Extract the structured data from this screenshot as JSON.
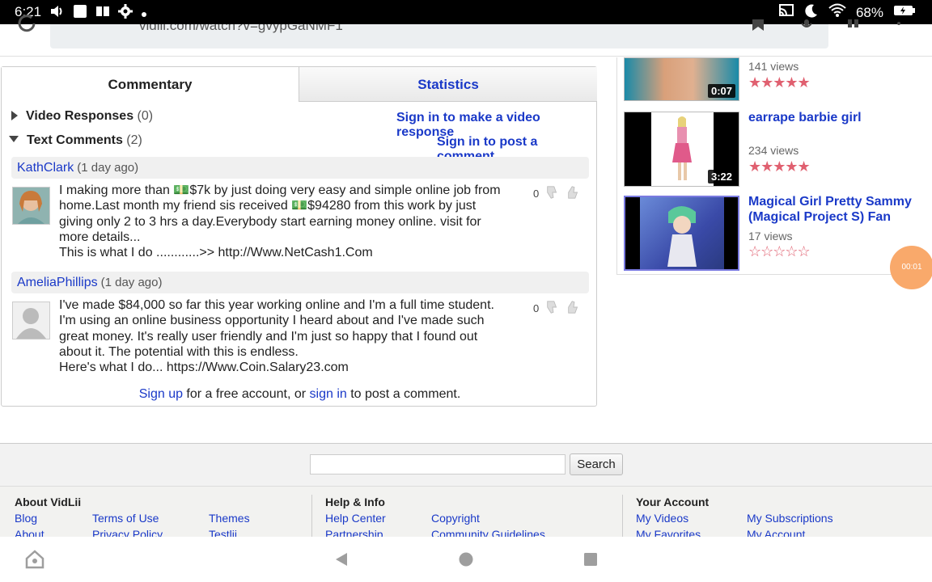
{
  "status_bar": {
    "time": "6:21",
    "battery": "68%"
  },
  "browser": {
    "url_fragment": "vidlii.com/watch?v=gvypGaNMF1"
  },
  "tabs": {
    "commentary": "Commentary",
    "statistics": "Statistics"
  },
  "sections": {
    "video_responses_label": "Video Responses",
    "video_responses_count": "(0)",
    "text_comments_label": "Text Comments",
    "text_comments_count": "(2)",
    "sign_in_video_response": "Sign in to make a video response",
    "sign_in_comment": "Sign in to post a comment"
  },
  "comments": [
    {
      "user": "KathClark",
      "ago": "(1 day ago)",
      "lines": [
        "I making more than 💵$7k by just doing very easy and simple online job from",
        "home.Last month my friend sis received 💵$94280 from this work by just",
        "giving only 2 to 3 hrs a day.Everybody start earning money online. visit for",
        "more details...",
        "This is what I do ............>> http://Www.NetCash1.Com"
      ],
      "votes": "0"
    },
    {
      "user": "AmeliaPhillips",
      "ago": "(1 day ago)",
      "lines": [
        "I've made $84,000 so far this year working online and I'm a full time student.",
        "I'm using an online business opportunity I heard about and I've made such",
        "great money. It's really user friendly and I'm just so happy that I found out",
        "about it. The potential with this is endless.",
        "Here's what I do... https://Www.Coin.Salary23.com"
      ],
      "votes": "0"
    }
  ],
  "signup_line": {
    "sign_up": "Sign up",
    "middle": " for a free account, or ",
    "sign_in": "sign in",
    "end": " to post a comment."
  },
  "related": [
    {
      "title": "",
      "views": "141 views",
      "duration": "0:07",
      "rating": 5
    },
    {
      "title": "earrape barbie girl",
      "views": "234 views",
      "duration": "3:22",
      "rating": 5
    },
    {
      "title": "Magical Girl Pretty Sammy (Magical Project S) Fan",
      "views": "17 views",
      "duration": "",
      "rating": 0
    }
  ],
  "bubble_text": "00:01",
  "footer": {
    "search_button": "Search",
    "col1": {
      "heading": "About VidLii",
      "links": [
        "Blog",
        "Terms of Use",
        "Themes",
        "About",
        "Privacy Policy",
        "Testlii"
      ]
    },
    "col2": {
      "heading": "Help & Info",
      "links": [
        "Help Center",
        "Copyright",
        "Partnership",
        "Community Guidelines"
      ]
    },
    "col3": {
      "heading": "Your Account",
      "links": [
        "My Videos",
        "My Subscriptions",
        "My Favorites",
        "My Account"
      ]
    }
  }
}
